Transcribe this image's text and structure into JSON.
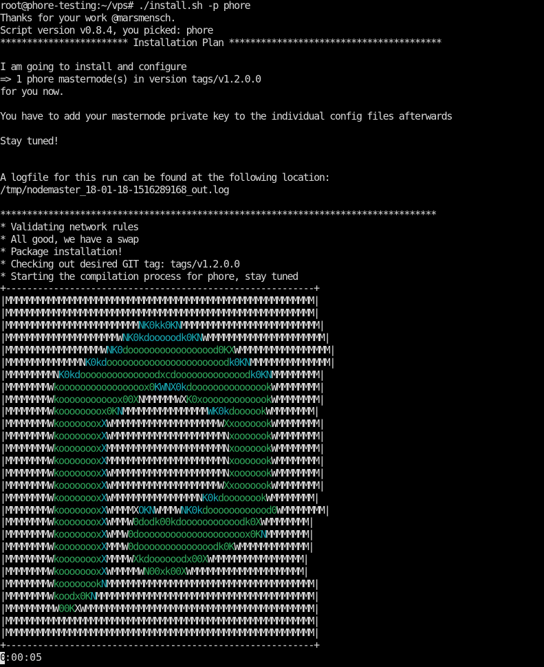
{
  "terminal": {
    "lines": [
      "root@phore-testing:~/vps# ./install.sh -p phore",
      "Thanks for your work @marsmensch.",
      "Script version v0.8.4, you picked: phore",
      "************************ Installation Plan ****************************************",
      "",
      "I am going to install and configure",
      "=> 1 phore masternode(s) in version tags/v1.2.0.0",
      "for you now.",
      "",
      "You have to add your masternode private key to the individual config files afterwards",
      "",
      "Stay tuned!",
      "",
      "",
      "A logfile for this run can be found at the following location:",
      "/tmp/nodemaster_18-01-18-1516289168_out.log",
      "",
      "**********************************************************************************",
      "* Validating network rules",
      "* All good, we have a swap",
      "* Package installation!",
      "* Checking out desired GIT tag: tags/v1.2.0.0",
      "* Starting the compilation process for phore, stay tuned"
    ],
    "art_border": "+----------------------------------------------------------+",
    "art_rows": [
      [
        [
          "w",
          "|MMMMMMMMMMMMMMMMMMMMMMMMMMMMMMMMMMMMMMMMMMMMMMMMMMMMMMMMMM|"
        ]
      ],
      [
        [
          "w",
          "|MMMMMMMMMMMMMMMMMMMMMMMMMMMMMMMMMMMMMMMMMMMMMMMMMMMMMMMMMM|"
        ]
      ],
      [
        [
          "w",
          "|MMMMMMMMMMMMMMMMMMMMMMMMM"
        ],
        [
          "c",
          "NK0kk0KN"
        ],
        [
          "w",
          "MMMMMMMMMMMMMMMMMMMMMMMMMM|"
        ]
      ],
      [
        [
          "w",
          "|MMMMMMMMMMMMMMMMMMMMMW"
        ],
        [
          "c",
          "NK0kdooooodk0KN"
        ],
        [
          "w",
          "WMMMMMMMMMMMMMMMMMMMMMM|"
        ]
      ],
      [
        [
          "w",
          "|MMMMMMMMMMMMMMMMMMW"
        ],
        [
          "c",
          "NK0"
        ],
        [
          "g",
          "dooooooooooooooood0KX"
        ],
        [
          "w",
          "WMMMMMMMMMMMMMMMMM|"
        ]
      ],
      [
        [
          "w",
          "|MMMMMMMMMMMMMMN"
        ],
        [
          "c",
          "K0kd"
        ],
        [
          "g",
          "ooooooooooooooooooooood"
        ],
        [
          "c",
          "k0KN"
        ],
        [
          "w",
          "MMMMMMMMMMMMMMM|"
        ]
      ],
      [
        [
          "w",
          "|MMMMMMMMMN"
        ],
        [
          "c",
          "K0kd"
        ],
        [
          "g",
          "oooooooooooooodxcdoooooooooooood"
        ],
        [
          "c",
          "k0KN"
        ],
        [
          "w",
          "MMMMMMMMM|"
        ]
      ],
      [
        [
          "w",
          "|MMMMMMMMW"
        ],
        [
          "g",
          "koooooooooooooooox0"
        ],
        [
          "c",
          "KWNX0k"
        ],
        [
          "g",
          "dooooooooooooook"
        ],
        [
          "w",
          "WMMMMMMMM|"
        ]
      ],
      [
        [
          "w",
          "|MMMMMMMMW"
        ],
        [
          "g",
          "kooooooooooox00X"
        ],
        [
          "w",
          "NMMMMMMWX"
        ],
        [
          "g",
          "K0xooooooooooook"
        ],
        [
          "w",
          "WMMMMMMMM|"
        ]
      ],
      [
        [
          "w",
          "|MMMMMMMMW"
        ],
        [
          "g",
          "koooooooox0K"
        ],
        [
          "c",
          "N"
        ],
        [
          "w",
          "MMMMMMMMMMMMMMMM"
        ],
        [
          "c",
          "WK0k"
        ],
        [
          "g",
          "doooook"
        ],
        [
          "w",
          "WMMMMMMMM|"
        ]
      ],
      [
        [
          "w",
          "|MMMMMMMMW"
        ],
        [
          "g",
          "kooooooox"
        ],
        [
          "c",
          "X"
        ],
        [
          "w",
          "WMMMMMMMMMMMMMMMMMMMMW"
        ],
        [
          "g",
          "Xxooooook"
        ],
        [
          "w",
          "WMMMMMMMM|"
        ]
      ],
      [
        [
          "w",
          "|MMMMMMMMW"
        ],
        [
          "g",
          "kooooooox"
        ],
        [
          "c",
          "X"
        ],
        [
          "w",
          "WMMMMMMMMMMMMMMMMMMMMMN"
        ],
        [
          "g",
          "xooooook"
        ],
        [
          "w",
          "WMMMMMMMM|"
        ]
      ],
      [
        [
          "w",
          "|MMMMMMMMW"
        ],
        [
          "g",
          "kooooooox"
        ],
        [
          "c",
          "X"
        ],
        [
          "w",
          "MMMMMMMMMMMMMMMMMMMMMMN"
        ],
        [
          "g",
          "xooooook"
        ],
        [
          "w",
          "WMMMMMMMM|"
        ]
      ],
      [
        [
          "w",
          "|MMMMMMMMW"
        ],
        [
          "g",
          "kooooooox"
        ],
        [
          "c",
          "X"
        ],
        [
          "w",
          "MMMMMMMMMMMMMMMMMMMMMMN"
        ],
        [
          "g",
          "xooooook"
        ],
        [
          "w",
          "WMMMMMMMM|"
        ]
      ],
      [
        [
          "w",
          "|MMMMMMMMW"
        ],
        [
          "g",
          "kooooooox"
        ],
        [
          "c",
          "X"
        ],
        [
          "w",
          "WMMMMMMMMMMMMMMMMMMMMMN"
        ],
        [
          "g",
          "xooooook"
        ],
        [
          "w",
          "WMMMMMMMM|"
        ]
      ],
      [
        [
          "w",
          "|MMMMMMMMW"
        ],
        [
          "g",
          "kooooooox"
        ],
        [
          "c",
          "X"
        ],
        [
          "w",
          "WMMMMMMMMMMMMMMMMMMMMW"
        ],
        [
          "g",
          "Xxooooook"
        ],
        [
          "w",
          "WMMMMMMMM|"
        ]
      ],
      [
        [
          "w",
          "|MMMMMMMMW"
        ],
        [
          "g",
          "kooooooox"
        ],
        [
          "c",
          "X"
        ],
        [
          "w",
          "WMMMMMMMMMMMMMMMMN"
        ],
        [
          "c",
          "K0k"
        ],
        [
          "g",
          "doooooook"
        ],
        [
          "w",
          "WMMMMMMMM|"
        ]
      ],
      [
        [
          "w",
          "|MMMMMMMMW"
        ],
        [
          "g",
          "kooooooox"
        ],
        [
          "c",
          "X"
        ],
        [
          "w",
          "WMMMMX"
        ],
        [
          "c",
          "OKN"
        ],
        [
          "w",
          "WMMMW"
        ],
        [
          "c",
          "NK0k"
        ],
        [
          "g",
          "doooooooooood0"
        ],
        [
          "w",
          "WMMMMMMMM|"
        ]
      ],
      [
        [
          "w",
          "|MMMMMMMMW"
        ],
        [
          "g",
          "kooooooox"
        ],
        [
          "c",
          "X"
        ],
        [
          "w",
          "WMMMW"
        ],
        [
          "g",
          "0dodk00kdooooooooooodk0X"
        ],
        [
          "w",
          "WMMMMMMMM|"
        ]
      ],
      [
        [
          "w",
          "|MMMMMMMMW"
        ],
        [
          "g",
          "kooooooox"
        ],
        [
          "c",
          "X"
        ],
        [
          "w",
          "WMMW"
        ],
        [
          "g",
          "0doooooooooooooooooooox0K"
        ],
        [
          "c",
          "N"
        ],
        [
          "w",
          "MMMMMMMM|"
        ]
      ],
      [
        [
          "w",
          "|MMMMMMMMW"
        ],
        [
          "g",
          "kooooooox"
        ],
        [
          "c",
          "X"
        ],
        [
          "w",
          "MMMW"
        ],
        [
          "g",
          "0doooooooooooooodk0K"
        ],
        [
          "w",
          "WMMMMMMMMMMMMM|"
        ]
      ],
      [
        [
          "w",
          "|MMMMMMMMW"
        ],
        [
          "g",
          "kooooooox"
        ],
        [
          "c",
          "X"
        ],
        [
          "w",
          "MMMMW"
        ],
        [
          "g",
          "Xkdoooooodx00X"
        ],
        [
          "w",
          "WMMMMMMMMMMMMMMMMM|"
        ]
      ],
      [
        [
          "w",
          "|MMMMMMMMW"
        ],
        [
          "g",
          "kooooooox"
        ],
        [
          "c",
          "X"
        ],
        [
          "w",
          "WMMMMMW"
        ],
        [
          "g",
          "N00xk00X"
        ],
        [
          "w",
          "WMMMMMMMMMMMMMMMMMMMMM|"
        ]
      ],
      [
        [
          "w",
          "|MMMMMMMMW"
        ],
        [
          "g",
          "koooooook"
        ],
        [
          "c",
          "N"
        ],
        [
          "w",
          "MMMMMMMMMMMMMMMMMMMMMMMMMMMMMMMMMMMMMMM|"
        ]
      ],
      [
        [
          "w",
          "|MMMMMMMMW"
        ],
        [
          "g",
          "koodx0K"
        ],
        [
          "c",
          "N"
        ],
        [
          "w",
          "MMMMMMMMMMMMMMMMMMMMMMMMMMMMMMMMMMMMMMMMM|"
        ]
      ],
      [
        [
          "w",
          "|MMMMMMMMMW"
        ],
        [
          "g",
          "00K"
        ],
        [
          "w",
          "XWMMMMMMMMMMMMMMMMMMMMMMMMMMMMMMMMMMMMMMMMMMM|"
        ]
      ],
      [
        [
          "w",
          "|MMMMMMMMMMMMMMMMMMMMMMMMMMMMMMMMMMMMMMMMMMMMMMMMMMMMMMMMMM|"
        ]
      ],
      [
        [
          "w",
          "|MMMMMMMMMMMMMMMMMMMMMMMMMMMMMMMMMMMMMMMMMMMMMMMMMMMMMMMMMM|"
        ]
      ]
    ],
    "timer_rest": ":00:05",
    "timer_first": "0",
    "colors": {
      "background": "#000000",
      "text": "#d8d8d8",
      "cyan": "#17a5b0",
      "green": "#2fa45a"
    }
  }
}
